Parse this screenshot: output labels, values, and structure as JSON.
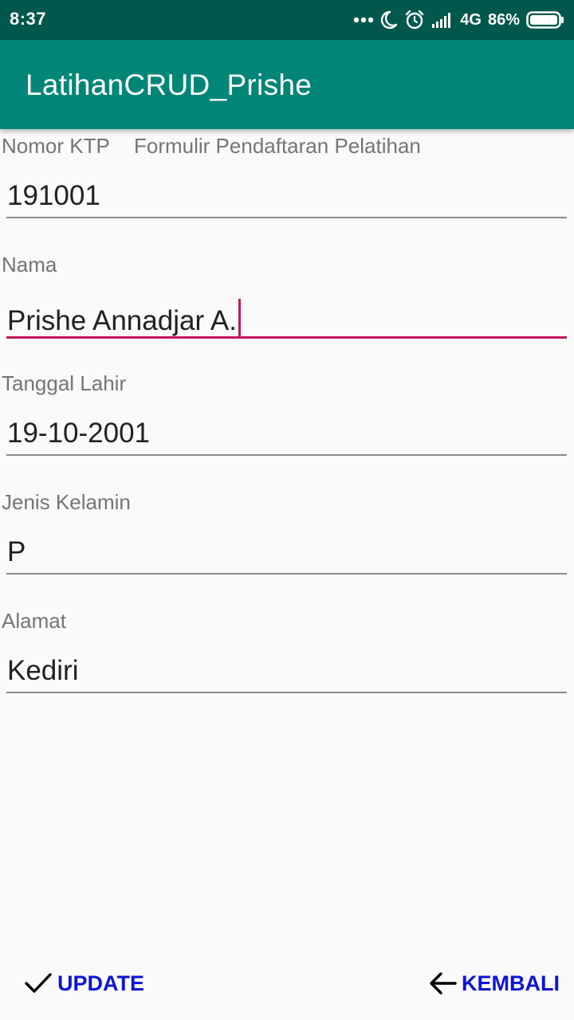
{
  "status_bar": {
    "time": "8:37",
    "network": "4G",
    "battery": "86%",
    "icons": [
      "more-dots-icon",
      "moon-icon",
      "alarm-icon",
      "signal-icon",
      "battery-icon"
    ]
  },
  "app_bar": {
    "title": "LatihanCRUD_Prishe"
  },
  "form": {
    "header_title": "Formulir Pendaftaran Pelatihan",
    "fields": [
      {
        "label": "Nomor KTP",
        "value": "191001"
      },
      {
        "label": "Nama",
        "value": "Prishe Annadjar A."
      },
      {
        "label": "Tanggal Lahir",
        "value": "19-10-2001"
      },
      {
        "label": "Jenis Kelamin",
        "value": "P"
      },
      {
        "label": "Alamat",
        "value": "Kediri"
      }
    ]
  },
  "actions": {
    "update_label": "UPDATE",
    "back_label": "KEMBALI",
    "update_icon": "check-icon",
    "back_icon": "arrow-left-icon"
  },
  "colors": {
    "status_bar": "#00574b",
    "app_bar": "#008577",
    "accent": "#c2185b",
    "button_text": "#0d15d6"
  }
}
